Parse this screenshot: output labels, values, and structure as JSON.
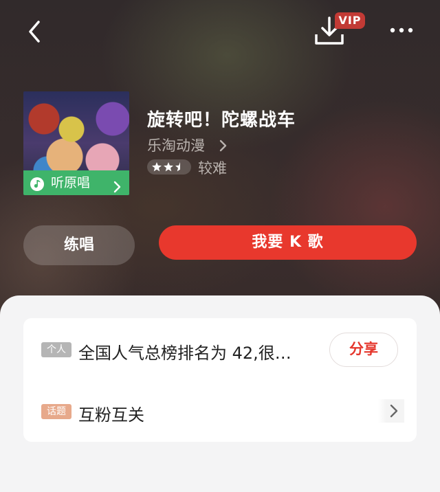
{
  "header": {
    "back_icon": "chevron-left-icon",
    "download_icon": "download-icon",
    "vip_badge": "VIP",
    "more_icon": "more-dots-icon"
  },
  "song": {
    "title": "旋转吧！陀螺战车",
    "artist": "乐淘动漫",
    "rating_stars": 2.5,
    "difficulty": "较难",
    "cover_button": "听原唱"
  },
  "actions": {
    "practice_label": "练唱",
    "sing_label": "我要 K 歌"
  },
  "info_card": {
    "rank": {
      "tag": "个人",
      "text": "全国人气总榜排名为 42,很…",
      "share_label": "分享"
    },
    "topic": {
      "tag": "话题",
      "text": "互粉互关"
    }
  },
  "colors": {
    "accent_red": "#e8382d",
    "cover_green": "#3fb46a",
    "vip_red": "#c23a35"
  }
}
